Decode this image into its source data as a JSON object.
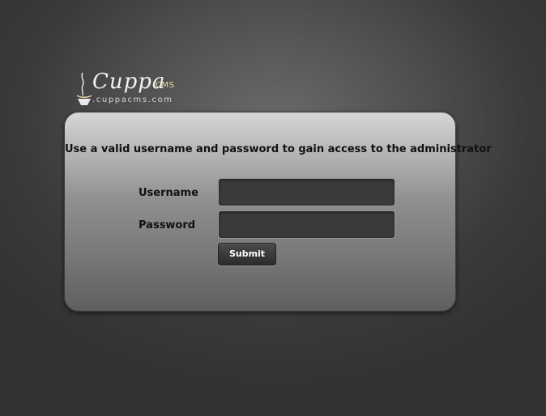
{
  "logo": {
    "word": "Cuppa",
    "suffix": "CMS",
    "url": ".cuppacms.com"
  },
  "login": {
    "message": "Use a valid username and password to gain access to the administrator",
    "username_label": "Username",
    "password_label": "Password",
    "username_value": "",
    "password_value": "",
    "submit_label": "Submit"
  },
  "colors": {
    "background": "#3a3a3a",
    "panel_top": "#d6d6d6",
    "panel_bottom": "#5f5f5f",
    "field_bg": "#3a3a3a",
    "button_bg": "#2c2c2c",
    "logo_suffix": "#e7d9a8"
  },
  "icons": {
    "logo_mark": "coffee-steam-icon"
  }
}
